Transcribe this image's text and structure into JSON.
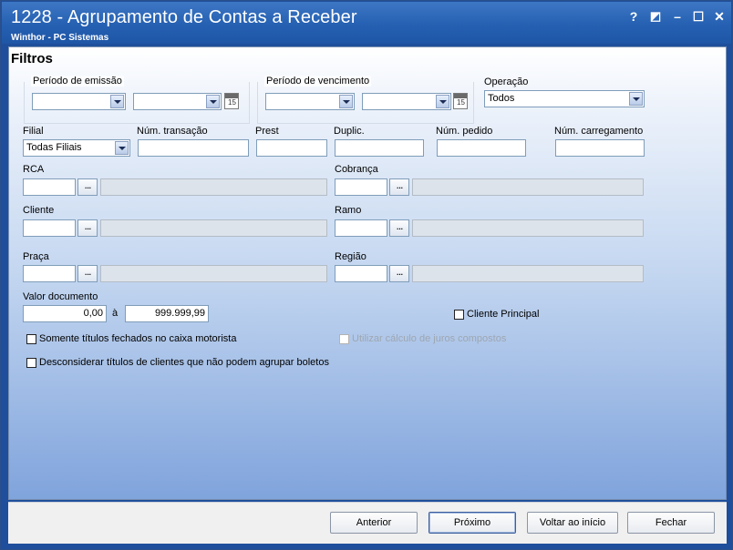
{
  "window": {
    "title": "1228 - Agrupamento de Contas a Receber",
    "subtitle": "Winthor - PC Sistemas",
    "help_glyph": "?",
    "restore_glyph": "◩",
    "min_glyph": "–",
    "max_glyph": "☐",
    "close_glyph": "✕"
  },
  "heading": "Filtros",
  "emissao": {
    "label": "Período de emissão",
    "start": "",
    "end": ""
  },
  "vencimento": {
    "label": "Período de vencimento",
    "start": "",
    "end": ""
  },
  "operacao": {
    "label": "Operação",
    "value": "Todos"
  },
  "filial": {
    "label": "Filial",
    "value": "Todas Filiais"
  },
  "fields": {
    "num_transacao": "Núm. transação",
    "prest": "Prest",
    "duplic": "Duplic.",
    "num_pedido": "Núm. pedido",
    "num_carregamento": "Núm. carregamento"
  },
  "lookups": {
    "rca": "RCA",
    "cobranca": "Cobrança",
    "cliente": "Cliente",
    "ramo": "Ramo",
    "praca": "Praça",
    "regiao": "Região",
    "dots": "..."
  },
  "valor": {
    "label": "Valor documento",
    "min": "0,00",
    "sep": "à",
    "max": "999.999,99"
  },
  "checks": {
    "cliente_principal": "Cliente Principal",
    "somente_fechados": "Somente títulos fechados no caixa motorista",
    "juros_compostos": "Utilizar cálculo de juros compostos",
    "desconsiderar": "Desconsiderar títulos de clientes que não podem agrupar boletos"
  },
  "calendar_num": "15",
  "buttons": {
    "anterior": "Anterior",
    "proximo": "Próximo",
    "voltar": "Voltar ao início",
    "fechar": "Fechar"
  }
}
